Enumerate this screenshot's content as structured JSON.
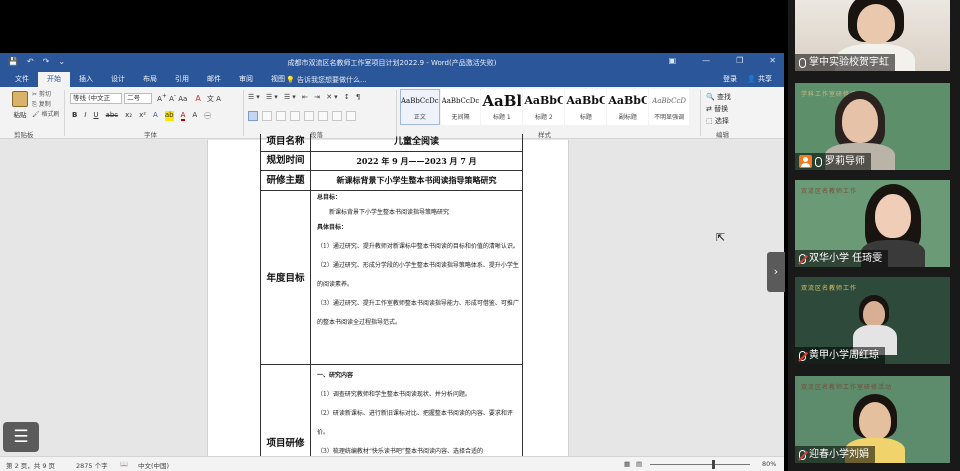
{
  "word": {
    "quick_access": [
      "💾",
      "↶",
      "↷",
      "⌄"
    ],
    "window_title": "成都市双流区名教师工作室项目计划2022.9 - Word(产品激活失败)",
    "window_controls": [
      "▣",
      "—",
      "❐",
      "✕"
    ],
    "tabs": [
      {
        "label": "文件",
        "active": false
      },
      {
        "label": "开始",
        "active": true
      },
      {
        "label": "插入",
        "active": false
      },
      {
        "label": "设计",
        "active": false
      },
      {
        "label": "布局",
        "active": false
      },
      {
        "label": "引用",
        "active": false
      },
      {
        "label": "邮件",
        "active": false
      },
      {
        "label": "审阅",
        "active": false
      },
      {
        "label": "视图",
        "active": false
      }
    ],
    "tell_me": "告诉我您想要做什么...",
    "login": "登录",
    "share": "共享",
    "ribbon": {
      "paste": "粘贴",
      "cut": "剪切",
      "copy": "复制",
      "format_painter": "格式刷",
      "clipboard_group": "剪贴板",
      "font_name": "等线 (中文正",
      "font_size": "二号",
      "font_group": "字体",
      "paragraph_group": "段落",
      "styles_group": "样式",
      "editing_group": "编辑",
      "find": "查找",
      "replace": "替换",
      "select": "选择",
      "styles": [
        {
          "preview": "AaBbCcDc",
          "name": "正文",
          "size": "7px",
          "selected": true
        },
        {
          "preview": "AaBbCcDc",
          "name": "无间隔",
          "size": "7px",
          "selected": false
        },
        {
          "preview": "AaBl",
          "name": "标题 1",
          "size": "15px",
          "selected": false
        },
        {
          "preview": "AaBbC",
          "name": "标题 2",
          "size": "11px",
          "selected": false
        },
        {
          "preview": "AaBbC",
          "name": "标题",
          "size": "11px",
          "selected": false
        },
        {
          "preview": "AaBbC",
          "name": "副标题",
          "size": "11px",
          "selected": false
        },
        {
          "preview": "AaBbCcD",
          "name": "不明显强调",
          "size": "7px",
          "selected": false
        }
      ]
    },
    "document": {
      "rows": {
        "project_name_label": "项目名称",
        "project_name_value": "儿童全阅读",
        "period_label": "规划时间",
        "period_value": "2022 年 9 月——2023 月 7 月",
        "theme_label": "研修主题",
        "theme_value": "新课标背景下小学生整本书阅读指导策略研究",
        "annual_goal_label": "年度目标",
        "content_label": "项目研修"
      },
      "annual_goal": {
        "total_heading": "总目标：",
        "total_text": "新课标背景下小学生整本书阅读指导策略研究",
        "specific_heading": "具体目标：",
        "items": [
          "（1）通过研究、提升教师对新课标中整本书阅读的目标和价值的清晰认识。",
          "（2）通过研究、形成分学段的小学生整本书阅读指导策略体系、提升小学生的阅读素养。",
          "（3）通过研究、提升工作室教师整本书阅读指导能力、形成可借鉴、可推广的整本书阅读全过程指导范式。"
        ]
      },
      "research_content": {
        "heading": "一、研究内容",
        "items": [
          "（1）调查研究教师和学生整本书阅读现状、并分析问题。",
          "（2）研读新课标、进行新旧课标对比、把握整本书阅读的内容、要求和评价。",
          "（3）梳理统编教材“快乐读书吧”整本书阅读内容、选择合适的"
        ]
      }
    },
    "status": {
      "pages": "第 2 页，共 9 页",
      "words": "2875 个字",
      "language": "中文(中国)",
      "zoom": "80%"
    }
  },
  "overlay": {
    "collapse_arrow": "›",
    "menu_icon": "☰"
  },
  "participants": [
    {
      "name": "掌中实验校贺宇虹",
      "mic": "on",
      "host": false,
      "banner": ""
    },
    {
      "name": "罗莉导师",
      "mic": "on",
      "host": true,
      "banner": "学科工作室研修活动"
    },
    {
      "name": "双华小学 任琦雯",
      "mic": "muted",
      "host": false,
      "banner": "双流区名教师工作"
    },
    {
      "name": "黄甲小学周红琼",
      "mic": "muted",
      "host": false,
      "banner": "双流区名教师工作"
    },
    {
      "name": "迎春小学刘娟",
      "mic": "muted",
      "host": false,
      "banner": "双流区名教师工作室研修活动"
    }
  ]
}
